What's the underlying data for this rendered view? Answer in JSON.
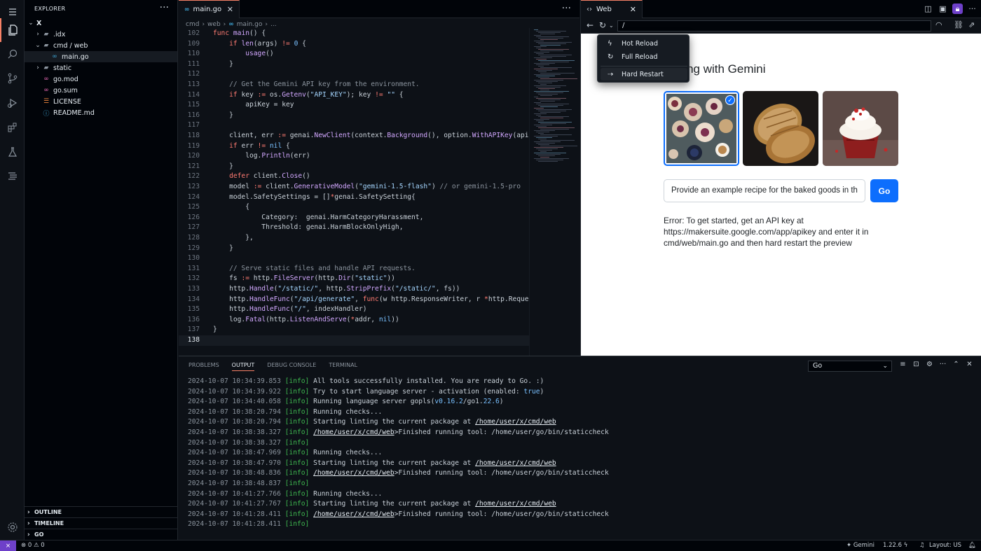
{
  "activity_bar": [
    "menu",
    "explorer",
    "search",
    "source-control",
    "run-debug",
    "extensions",
    "testing",
    "outline",
    "settings"
  ],
  "sidebar": {
    "title": "EXPLORER",
    "root": "X",
    "items": [
      {
        "label": ".idx",
        "type": "folder",
        "expanded": false,
        "depth": 1
      },
      {
        "label": "cmd / web",
        "type": "folder",
        "expanded": true,
        "depth": 1
      },
      {
        "label": "main.go",
        "type": "go",
        "depth": 2,
        "selected": true
      },
      {
        "label": "static",
        "type": "folder",
        "expanded": false,
        "depth": 1
      },
      {
        "label": "go.mod",
        "type": "gomod",
        "depth": 1
      },
      {
        "label": "go.sum",
        "type": "gomod",
        "depth": 1
      },
      {
        "label": "LICENSE",
        "type": "license",
        "depth": 1
      },
      {
        "label": "README.md",
        "type": "md",
        "depth": 1
      }
    ],
    "sections": [
      "OUTLINE",
      "TIMELINE",
      "GO"
    ]
  },
  "editor": {
    "tab": "main.go",
    "breadcrumb": [
      "cmd",
      "web",
      "main.go",
      "..."
    ],
    "current_line": 138,
    "lines": [
      {
        "n": 102,
        "code": "func main() {",
        "sticky": true
      },
      {
        "n": 109,
        "code": "    if len(args) != 0 {"
      },
      {
        "n": 110,
        "code": "        usage()"
      },
      {
        "n": 111,
        "code": "    }"
      },
      {
        "n": 112,
        "code": ""
      },
      {
        "n": 113,
        "code": "    // Get the Gemini API key from the environment."
      },
      {
        "n": 114,
        "code": "    if key := os.Getenv(\"API_KEY\"); key != \"\" {"
      },
      {
        "n": 115,
        "code": "        apiKey = key"
      },
      {
        "n": 116,
        "code": "    }"
      },
      {
        "n": 117,
        "code": ""
      },
      {
        "n": 118,
        "code": "    client, err := genai.NewClient(context.Background(), option.WithAPIKey(apiK"
      },
      {
        "n": 119,
        "code": "    if err != nil {"
      },
      {
        "n": 120,
        "code": "        log.Println(err)"
      },
      {
        "n": 121,
        "code": "    }"
      },
      {
        "n": 122,
        "code": "    defer client.Close()"
      },
      {
        "n": 123,
        "code": "    model := client.GenerativeModel(\"gemini-1.5-flash\") // or gemini-1.5-pro"
      },
      {
        "n": 124,
        "code": "    model.SafetySettings = []*genai.SafetySetting{"
      },
      {
        "n": 125,
        "code": "        {"
      },
      {
        "n": 126,
        "code": "            Category:  genai.HarmCategoryHarassment,"
      },
      {
        "n": 127,
        "code": "            Threshold: genai.HarmBlockOnlyHigh,"
      },
      {
        "n": 128,
        "code": "        },"
      },
      {
        "n": 129,
        "code": "    }"
      },
      {
        "n": 130,
        "code": ""
      },
      {
        "n": 131,
        "code": "    // Serve static files and handle API requests."
      },
      {
        "n": 132,
        "code": "    fs := http.FileServer(http.Dir(\"static\"))"
      },
      {
        "n": 133,
        "code": "    http.Handle(\"/static/\", http.StripPrefix(\"/static/\", fs))"
      },
      {
        "n": 134,
        "code": "    http.HandleFunc(\"/api/generate\", func(w http.ResponseWriter, r *http.Reques"
      },
      {
        "n": 135,
        "code": "    http.HandleFunc(\"/\", indexHandler)"
      },
      {
        "n": 136,
        "code": "    log.Fatal(http.ListenAndServe(*addr, nil))"
      },
      {
        "n": 137,
        "code": "}"
      },
      {
        "n": 138,
        "code": ""
      }
    ]
  },
  "web_preview": {
    "tab": "Web",
    "url": "/",
    "menu": [
      {
        "label": "Hot Reload",
        "icon": "bolt-icon"
      },
      {
        "label": "Full Reload",
        "icon": "reload-icon"
      },
      {
        "label": "Hard Restart",
        "icon": "restart-icon",
        "highlighted": true
      }
    ],
    "app": {
      "title": "Baking with Gemini",
      "images": [
        {
          "name": "baked-goods-table-image",
          "selected": true
        },
        {
          "name": "bread-loaves-image",
          "selected": false
        },
        {
          "name": "red-velvet-cupcake-image",
          "selected": false
        }
      ],
      "prompt_value": "Provide an example recipe for the baked goods in th",
      "go_label": "Go",
      "error": "Error: To get started, get an API key at https://makersuite.google.com/app/apikey and enter it in cmd/web/main.go and then hard restart the preview"
    }
  },
  "panel": {
    "tabs": [
      "PROBLEMS",
      "OUTPUT",
      "DEBUG CONSOLE",
      "TERMINAL"
    ],
    "active_tab": "OUTPUT",
    "channel": "Go",
    "log": [
      {
        "ts": "2024-10-07 10:34:39.853",
        "lvl": "[info]",
        "msg": "All tools successfully installed. You are ready to Go. :)"
      },
      {
        "ts": "2024-10-07 10:34:39.922",
        "lvl": "[info]",
        "msg": "Try to start language server - activation (enabled: true)"
      },
      {
        "ts": "2024-10-07 10:34:40.058",
        "lvl": "[info]",
        "msg": "Running language server gopls(v0.16.2/go1.22.6)"
      },
      {
        "ts": "2024-10-07 10:38:20.794",
        "lvl": "[info]",
        "msg": "Running checks..."
      },
      {
        "ts": "2024-10-07 10:38:20.794",
        "lvl": "[info]",
        "msg": "Starting linting the current package at ",
        "link": "/home/user/x/cmd/web"
      },
      {
        "ts": "2024-10-07 10:38:38.327",
        "lvl": "[info]",
        "link_first": "/home/user/x/cmd/web",
        "msg": ">Finished running tool: /home/user/go/bin/staticcheck"
      },
      {
        "ts": "2024-10-07 10:38:38.327",
        "lvl": "[info]",
        "msg": ""
      },
      {
        "ts": "2024-10-07 10:38:47.969",
        "lvl": "[info]",
        "msg": "Running checks..."
      },
      {
        "ts": "2024-10-07 10:38:47.970",
        "lvl": "[info]",
        "msg": "Starting linting the current package at ",
        "link": "/home/user/x/cmd/web"
      },
      {
        "ts": "2024-10-07 10:38:48.836",
        "lvl": "[info]",
        "link_first": "/home/user/x/cmd/web",
        "msg": ">Finished running tool: /home/user/go/bin/staticcheck"
      },
      {
        "ts": "2024-10-07 10:38:48.837",
        "lvl": "[info]",
        "msg": ""
      },
      {
        "ts": "2024-10-07 10:41:27.766",
        "lvl": "[info]",
        "msg": "Running checks..."
      },
      {
        "ts": "2024-10-07 10:41:27.767",
        "lvl": "[info]",
        "msg": "Starting linting the current package at ",
        "link": "/home/user/x/cmd/web"
      },
      {
        "ts": "2024-10-07 10:41:28.411",
        "lvl": "[info]",
        "link_first": "/home/user/x/cmd/web",
        "msg": ">Finished running tool: /home/user/go/bin/staticcheck"
      },
      {
        "ts": "2024-10-07 10:41:28.411",
        "lvl": "[info]",
        "msg": ""
      }
    ]
  },
  "status_bar": {
    "errors": "0",
    "warnings": "0",
    "gemini": "Gemini",
    "go_version": "1.22.6",
    "layout": "Layout: US"
  },
  "colors": {
    "accent": "#f78166",
    "button_blue": "#0d6efd",
    "remote_purple": "#6e40c9"
  }
}
